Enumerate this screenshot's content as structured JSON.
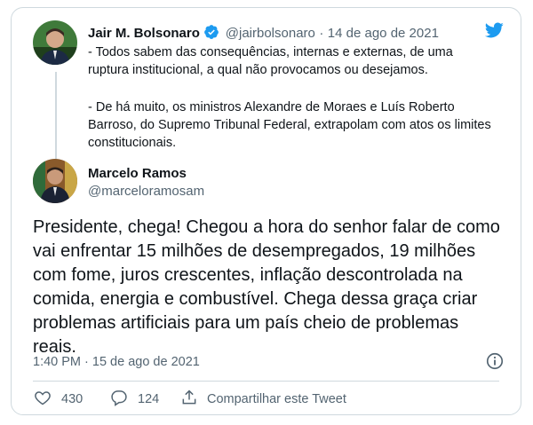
{
  "quoted_tweet": {
    "author_name": "Jair M. Bolsonaro",
    "handle": "@jairbolsonaro",
    "separator": "·",
    "date": "14 de ago de 2021",
    "paragraph_1": "- Todos sabem das consequências, internas e externas, de uma ruptura institucional, a qual não provocamos ou desejamos.",
    "paragraph_2": "- De há muito, os ministros Alexandre de Moraes e Luís Roberto Barroso, do Supremo Tribunal Federal, extrapolam com atos os limites constitucionais."
  },
  "reply": {
    "author_name": "Marcelo Ramos",
    "handle": "@marceloramosam",
    "text": "Presidente, chega! Chegou a hora do senhor falar de como vai enfrentar 15 milhões de desempregados, 19 milhões com fome, juros crescentes, inflação descontrolada na comida, energia e combustível. Chega dessa graça criar problemas artificiais para um país cheio de problemas reais.",
    "timestamp": "1:40 PM · 15 de ago de 2021"
  },
  "actions": {
    "likes": "430",
    "replies": "124",
    "share_label": "Compartilhar este Tweet"
  },
  "icons": {
    "brand": "twitter-bird-icon",
    "verified": "verified-badge-icon",
    "info": "info-icon",
    "like": "heart-icon",
    "reply": "comment-icon",
    "share": "share-icon"
  },
  "colors": {
    "twitter_blue": "#1d9bf0",
    "muted": "#536471",
    "border": "#cfd9de"
  }
}
